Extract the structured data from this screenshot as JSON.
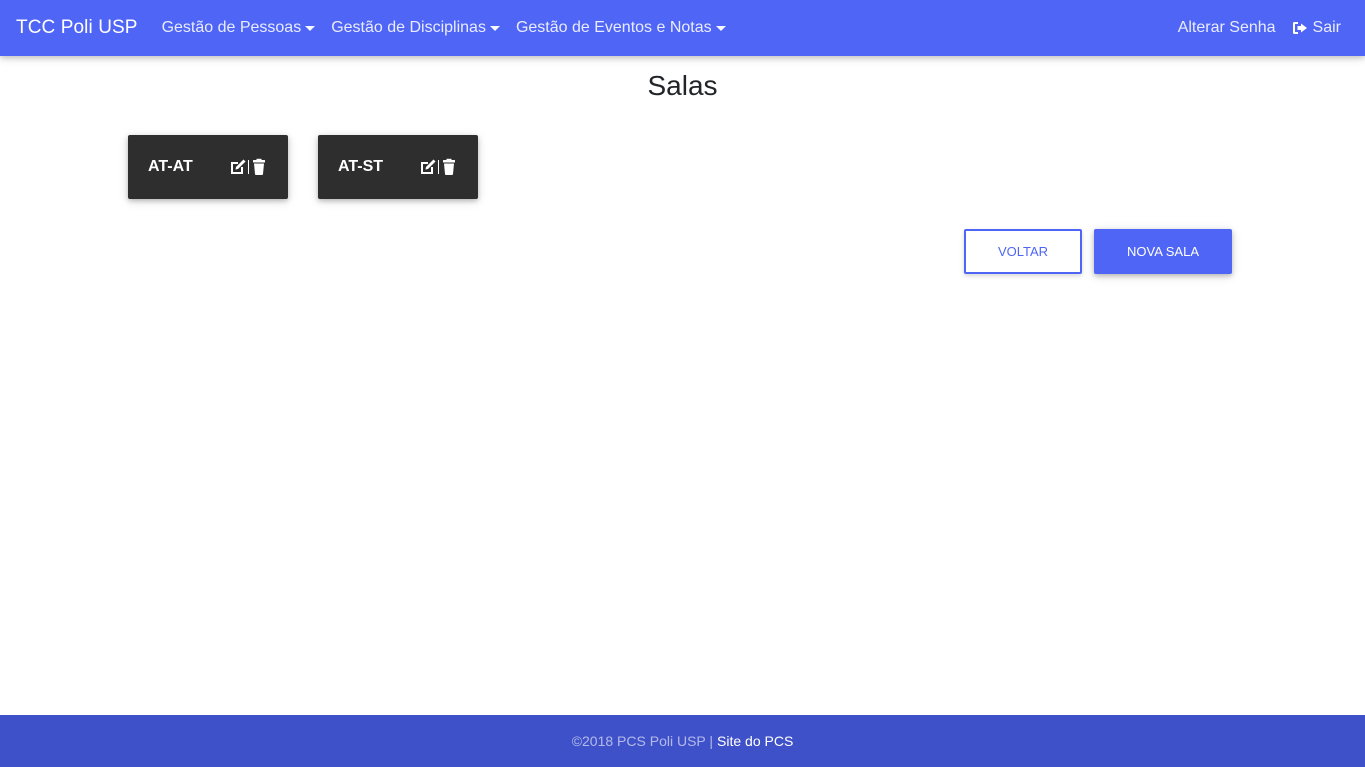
{
  "navbar": {
    "brand": "TCC Poli USP",
    "menus": [
      {
        "label": "Gestão de Pessoas"
      },
      {
        "label": "Gestão de Disciplinas"
      },
      {
        "label": "Gestão de Eventos e Notas"
      }
    ],
    "right": {
      "change_password": "Alterar Senha",
      "logout": "Sair",
      "logout_icon": "sign-out-icon"
    }
  },
  "page": {
    "title": "Salas"
  },
  "rooms": [
    {
      "name": "AT-AT",
      "edit_icon": "edit-icon",
      "delete_icon": "trash-icon"
    },
    {
      "name": "AT-ST",
      "edit_icon": "edit-icon",
      "delete_icon": "trash-icon"
    }
  ],
  "actions": {
    "back_label": "VOLTAR",
    "new_room_label": "NOVA SALA"
  },
  "footer": {
    "copyright": "©2018 PCS Poli USP |",
    "link_label": "Site do PCS"
  },
  "colors": {
    "primary": "#4f65f5",
    "footer": "#3f51c9",
    "card": "#2e2e2e"
  }
}
